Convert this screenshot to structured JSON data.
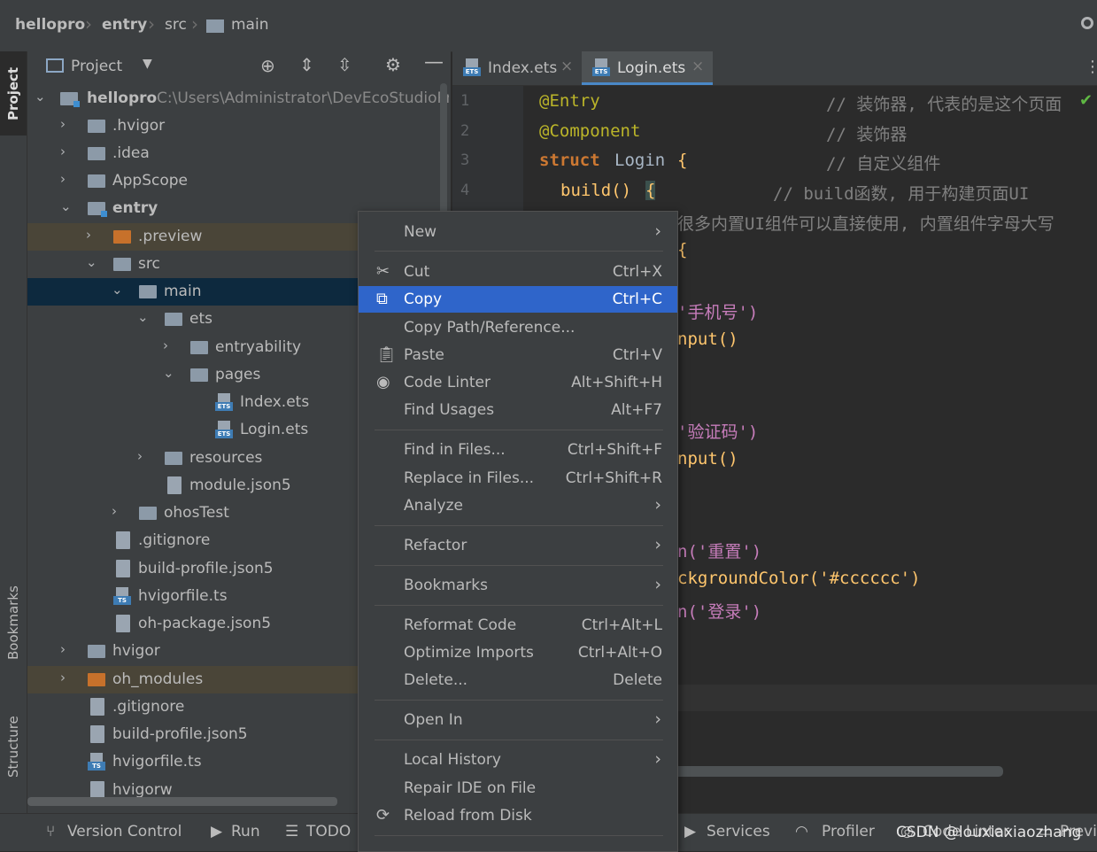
{
  "breadcrumb": [
    "hellopro",
    "entry",
    "src",
    "main"
  ],
  "left_stripe": {
    "project": "Project",
    "bookmarks": "Bookmarks",
    "structure": "Structure"
  },
  "project_panel": {
    "title": "Project",
    "root_path": "C:\\Users\\Administrator\\DevEcoStudioPro"
  },
  "tree": [
    {
      "label": "hellopro",
      "icon": "module-folder-icon"
    },
    {
      "label": ".hvigor",
      "icon": "folder-icon"
    },
    {
      "label": ".idea",
      "icon": "folder-icon"
    },
    {
      "label": "AppScope",
      "icon": "folder-icon"
    },
    {
      "label": "entry",
      "icon": "module-folder-icon"
    },
    {
      "label": ".preview",
      "icon": "excluded-folder-icon"
    },
    {
      "label": "src",
      "icon": "folder-icon"
    },
    {
      "label": "main",
      "icon": "folder-icon"
    },
    {
      "label": "ets",
      "icon": "folder-icon"
    },
    {
      "label": "entryability",
      "icon": "folder-icon"
    },
    {
      "label": "pages",
      "icon": "folder-icon"
    },
    {
      "label": "Index.ets",
      "icon": "ets-file-icon"
    },
    {
      "label": "Login.ets",
      "icon": "ets-file-icon"
    },
    {
      "label": "resources",
      "icon": "folder-icon"
    },
    {
      "label": "module.json5",
      "icon": "json-file-icon"
    },
    {
      "label": "ohosTest",
      "icon": "folder-icon"
    },
    {
      "label": ".gitignore",
      "icon": "gitignore-file-icon"
    },
    {
      "label": "build-profile.json5",
      "icon": "json-file-icon"
    },
    {
      "label": "hvigorfile.ts",
      "icon": "ts-file-icon"
    },
    {
      "label": "oh-package.json5",
      "icon": "json-file-icon"
    },
    {
      "label": "hvigor",
      "icon": "folder-icon"
    },
    {
      "label": "oh_modules",
      "icon": "excluded-folder-icon"
    },
    {
      "label": ".gitignore",
      "icon": "gitignore-file-icon"
    },
    {
      "label": "build-profile.json5",
      "icon": "json-file-icon"
    },
    {
      "label": "hvigorfile.ts",
      "icon": "ts-file-icon"
    },
    {
      "label": "hvigorw",
      "icon": "script-file-icon"
    }
  ],
  "editor_tabs": [
    {
      "label": "Index.ets"
    },
    {
      "label": "Login.ets"
    }
  ],
  "code": {
    "line_numbers": [
      "1",
      "2",
      "3",
      "4"
    ],
    "l1_ann": "@Entry",
    "l1_cm": "// 装饰器, 代表的是这个页面",
    "l2_ann": "@Component",
    "l2_cm": "// 装饰器",
    "l3_kw": "struct",
    "l3_name": "Login",
    "l3_brace": "{",
    "l3_cm": "// 自定义组件",
    "l4_fn": "build()",
    "l4_brace": "{",
    "l4_cm": "// build函数, 用于构建页面UI",
    "l5": "很多内置UI组件可以直接使用, 内置组件字母大写",
    "l6": "{",
    "l8": "'手机号')",
    "l9": "nput()",
    "l12": "'验证码')",
    "l13": "nput()",
    "l16": "n('重置')",
    "l17": "ckgroundColor('#cccccc')",
    "l18": "n('登录')"
  },
  "context_menu": {
    "items": [
      {
        "label": "New",
        "shortcut": "",
        "submenu": true
      },
      {
        "label": "Cut",
        "shortcut": "Ctrl+X",
        "icon": "scissors-icon"
      },
      {
        "label": "Copy",
        "shortcut": "Ctrl+C",
        "icon": "copy-icon",
        "selected": true
      },
      {
        "label": "Copy Path/Reference...",
        "shortcut": ""
      },
      {
        "label": "Paste",
        "shortcut": "Ctrl+V",
        "icon": "clipboard-icon"
      },
      {
        "label": "Code Linter",
        "shortcut": "Alt+Shift+H",
        "icon": "code-linter-icon"
      },
      {
        "label": "Find Usages",
        "shortcut": "Alt+F7"
      },
      {
        "label": "Find in Files...",
        "shortcut": "Ctrl+Shift+F"
      },
      {
        "label": "Replace in Files...",
        "shortcut": "Ctrl+Shift+R"
      },
      {
        "label": "Analyze",
        "shortcut": "",
        "submenu": true
      },
      {
        "label": "Refactor",
        "shortcut": "",
        "submenu": true
      },
      {
        "label": "Bookmarks",
        "shortcut": "",
        "submenu": true
      },
      {
        "label": "Reformat Code",
        "shortcut": "Ctrl+Alt+L"
      },
      {
        "label": "Optimize Imports",
        "shortcut": "Ctrl+Alt+O"
      },
      {
        "label": "Delete...",
        "shortcut": "Delete"
      },
      {
        "label": "Open In",
        "shortcut": "",
        "submenu": true
      },
      {
        "label": "Local History",
        "shortcut": "",
        "submenu": true
      },
      {
        "label": "Repair IDE on File",
        "shortcut": ""
      },
      {
        "label": "Reload from Disk",
        "shortcut": "",
        "icon": "reload-icon"
      }
    ]
  },
  "bottom_bar": {
    "version_control": "Version Control",
    "run": "Run",
    "todo": "TODO",
    "services": "Services",
    "profiler": "Profiler",
    "code_linter": "Code Linter",
    "preview": "Previ"
  },
  "watermark": "CSDN @louxiaxiaozhang",
  "colors": {
    "selection": "#2f65ca",
    "tree_selection": "#0d293e",
    "ide_bg": "#2b2b2b",
    "panel_bg": "#3c3f41"
  }
}
